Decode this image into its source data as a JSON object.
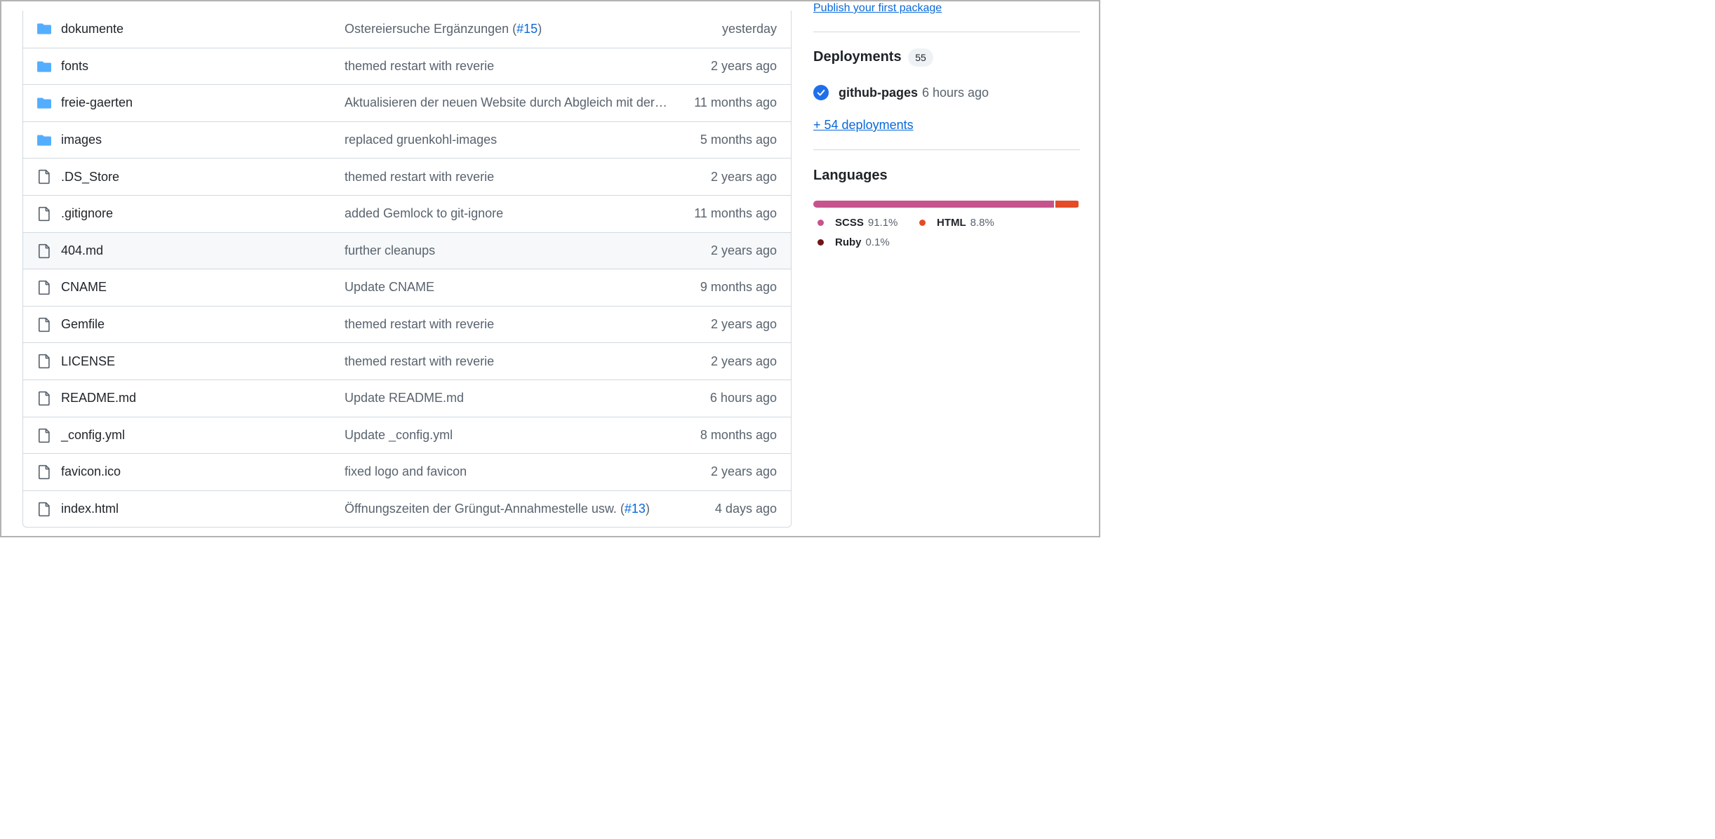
{
  "files": [
    {
      "type": "dir",
      "name": "dokumente",
      "message": "Ostereiersuche Ergänzungen (",
      "pr": "#15",
      "suffix": ")",
      "age": "yesterday"
    },
    {
      "type": "dir",
      "name": "fonts",
      "message": "themed restart with reverie",
      "pr": "",
      "suffix": "",
      "age": "2 years ago"
    },
    {
      "type": "dir",
      "name": "freie-gaerten",
      "message": "Aktualisieren der neuen Website durch Abgleich mit der alten",
      "pr": "",
      "suffix": "",
      "age": "11 months ago"
    },
    {
      "type": "dir",
      "name": "images",
      "message": "replaced gruenkohl-images",
      "pr": "",
      "suffix": "",
      "age": "5 months ago"
    },
    {
      "type": "file",
      "name": ".DS_Store",
      "message": "themed restart with reverie",
      "pr": "",
      "suffix": "",
      "age": "2 years ago"
    },
    {
      "type": "file",
      "name": ".gitignore",
      "message": "added Gemlock to git-ignore",
      "pr": "",
      "suffix": "",
      "age": "11 months ago"
    },
    {
      "type": "file",
      "name": "404.md",
      "message": "further cleanups",
      "pr": "",
      "suffix": "",
      "age": "2 years ago"
    },
    {
      "type": "file",
      "name": "CNAME",
      "message": "Update CNAME",
      "pr": "",
      "suffix": "",
      "age": "9 months ago"
    },
    {
      "type": "file",
      "name": "Gemfile",
      "message": "themed restart with reverie",
      "pr": "",
      "suffix": "",
      "age": "2 years ago"
    },
    {
      "type": "file",
      "name": "LICENSE",
      "message": "themed restart with reverie",
      "pr": "",
      "suffix": "",
      "age": "2 years ago"
    },
    {
      "type": "file",
      "name": "README.md",
      "message": "Update README.md",
      "pr": "",
      "suffix": "",
      "age": "6 hours ago"
    },
    {
      "type": "file",
      "name": "_config.yml",
      "message": "Update _config.yml",
      "pr": "",
      "suffix": "",
      "age": "8 months ago"
    },
    {
      "type": "file",
      "name": "favicon.ico",
      "message": "fixed logo and favicon",
      "pr": "",
      "suffix": "",
      "age": "2 years ago"
    },
    {
      "type": "file",
      "name": "index.html",
      "message": "Öffnungszeiten der Grüngut-Annahmestelle usw. (",
      "pr": "#13",
      "suffix": ")",
      "age": "4 days ago"
    }
  ],
  "sidebar": {
    "packages_link": "Publish your first package",
    "deployments": {
      "title": "Deployments",
      "count": "55",
      "latest_env": "github-pages",
      "latest_when": "6 hours ago",
      "more_link": "+ 54 deployments"
    },
    "languages": {
      "title": "Languages",
      "items": [
        {
          "name": "SCSS",
          "percent": "91.1%",
          "value": 91.1,
          "color": "#c6538c"
        },
        {
          "name": "HTML",
          "percent": "8.8%",
          "value": 8.8,
          "color": "#e34c26"
        },
        {
          "name": "Ruby",
          "percent": "0.1%",
          "value": 0.1,
          "color": "#701516"
        }
      ]
    }
  },
  "colors": {
    "folder": "#54aeff",
    "file_icon": "#59636e",
    "link": "#0969da",
    "check": "#1f6feb"
  },
  "icons": {
    "dir": "folder-icon",
    "file": "file-icon",
    "deploy": "check-circle-icon"
  }
}
